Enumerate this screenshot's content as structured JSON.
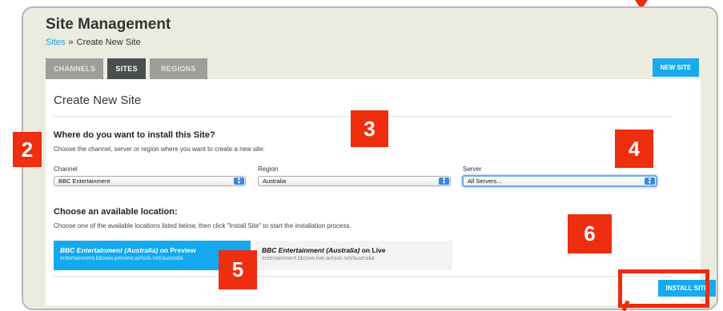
{
  "header": {
    "title": "Site Management",
    "breadcrumb": {
      "root": "Sites",
      "separator": "»",
      "current": "Create New Site"
    }
  },
  "tabs": [
    {
      "label": "CHANNELS",
      "active": false
    },
    {
      "label": "SITES",
      "active": true
    },
    {
      "label": "REGIONS",
      "active": false
    }
  ],
  "toolbar": {
    "new_site_label": "NEW SITE"
  },
  "panel": {
    "title": "Create New Site",
    "install_section": {
      "heading": "Where do you want to install this Site?",
      "help": "Choose the channel, server or region where you want to create a new site:"
    },
    "fields": {
      "channel": {
        "label": "Channel",
        "value": "BBC Entertainment"
      },
      "region": {
        "label": "Region",
        "value": "Australia"
      },
      "server": {
        "label": "Server",
        "value": "All Servers..."
      }
    },
    "location_section": {
      "heading": "Choose an available location:",
      "help": "Choose one of the available locations listed below, then click \"Install Site\" to start the installation process."
    },
    "locations": [
      {
        "name": "BBC Entertainment",
        "region": "(Australia)",
        "target": "on Preview",
        "url": "entertainment.bbcww.preview.airlock.net/australia",
        "selected": true
      },
      {
        "name": "BBC Entertainment",
        "region": "(Australia)",
        "target": "on Live",
        "url": "entertainment.bbcww.live.airlock.net/australia",
        "selected": false
      }
    ],
    "install_label": "INSTALL SITE"
  },
  "callouts": [
    "2",
    "3",
    "4",
    "5",
    "6"
  ],
  "colors": {
    "accent": "#19aaee",
    "callout": "#ef2d0f",
    "tab_active": "#4a4e4e",
    "tab_inactive": "#9c9e9a"
  }
}
